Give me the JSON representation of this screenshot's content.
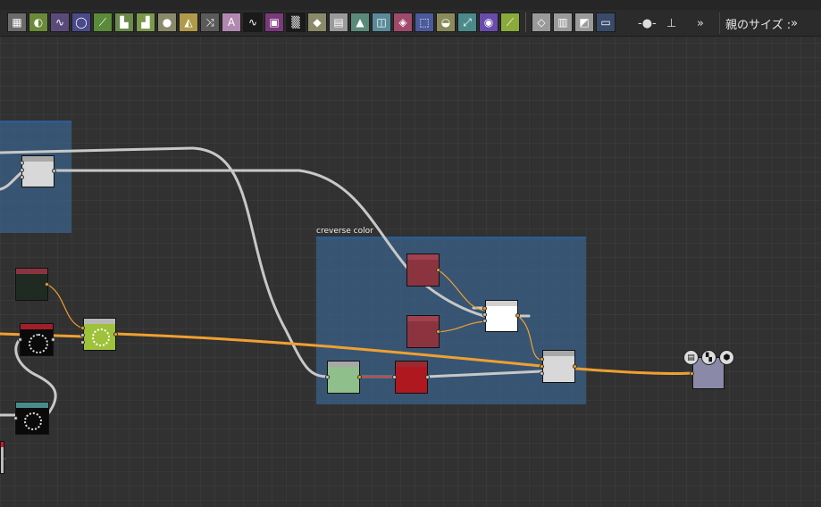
{
  "toolbar": {
    "icons": [
      "grid-icon",
      "uniform-color-icon",
      "curve-icon",
      "ellipse-icon",
      "levels-icon",
      "output-node-icon",
      "input-node-icon",
      "slider-icon",
      "warp-icon",
      "switch-icon",
      "text-icon",
      "gradient-01-icon",
      "image-icon",
      "noise-01-icon",
      "drop-icon",
      "blend-icon",
      "histogram-icon",
      "transform-icon",
      "fill-icon",
      "selection-icon",
      "normal-icon",
      "gradient-map-icon",
      "color-wheel-icon",
      "edit-icon",
      "node-icon",
      "panel-icon",
      "frame-icon",
      "comment-icon"
    ],
    "overflow": "»",
    "parent_size_label": "親のサイズ :",
    "parent_size_overflow": "»"
  },
  "frames": [
    {
      "id": "frame-left",
      "title": ""
    },
    {
      "id": "frame-reverse-color",
      "title": "creverse color"
    }
  ],
  "colors": {
    "background": "#313131",
    "frame": "#3a6896",
    "wire_gray": "#c8c8c8",
    "wire_orange": "#f0a030",
    "node_red": "#8b3440",
    "node_green": "#8fbf8a",
    "node_lime": "#9ec23a",
    "node_output": "#8a8aa8"
  },
  "output_badges": [
    "document-icon",
    "checker-icon",
    "cube-icon"
  ]
}
